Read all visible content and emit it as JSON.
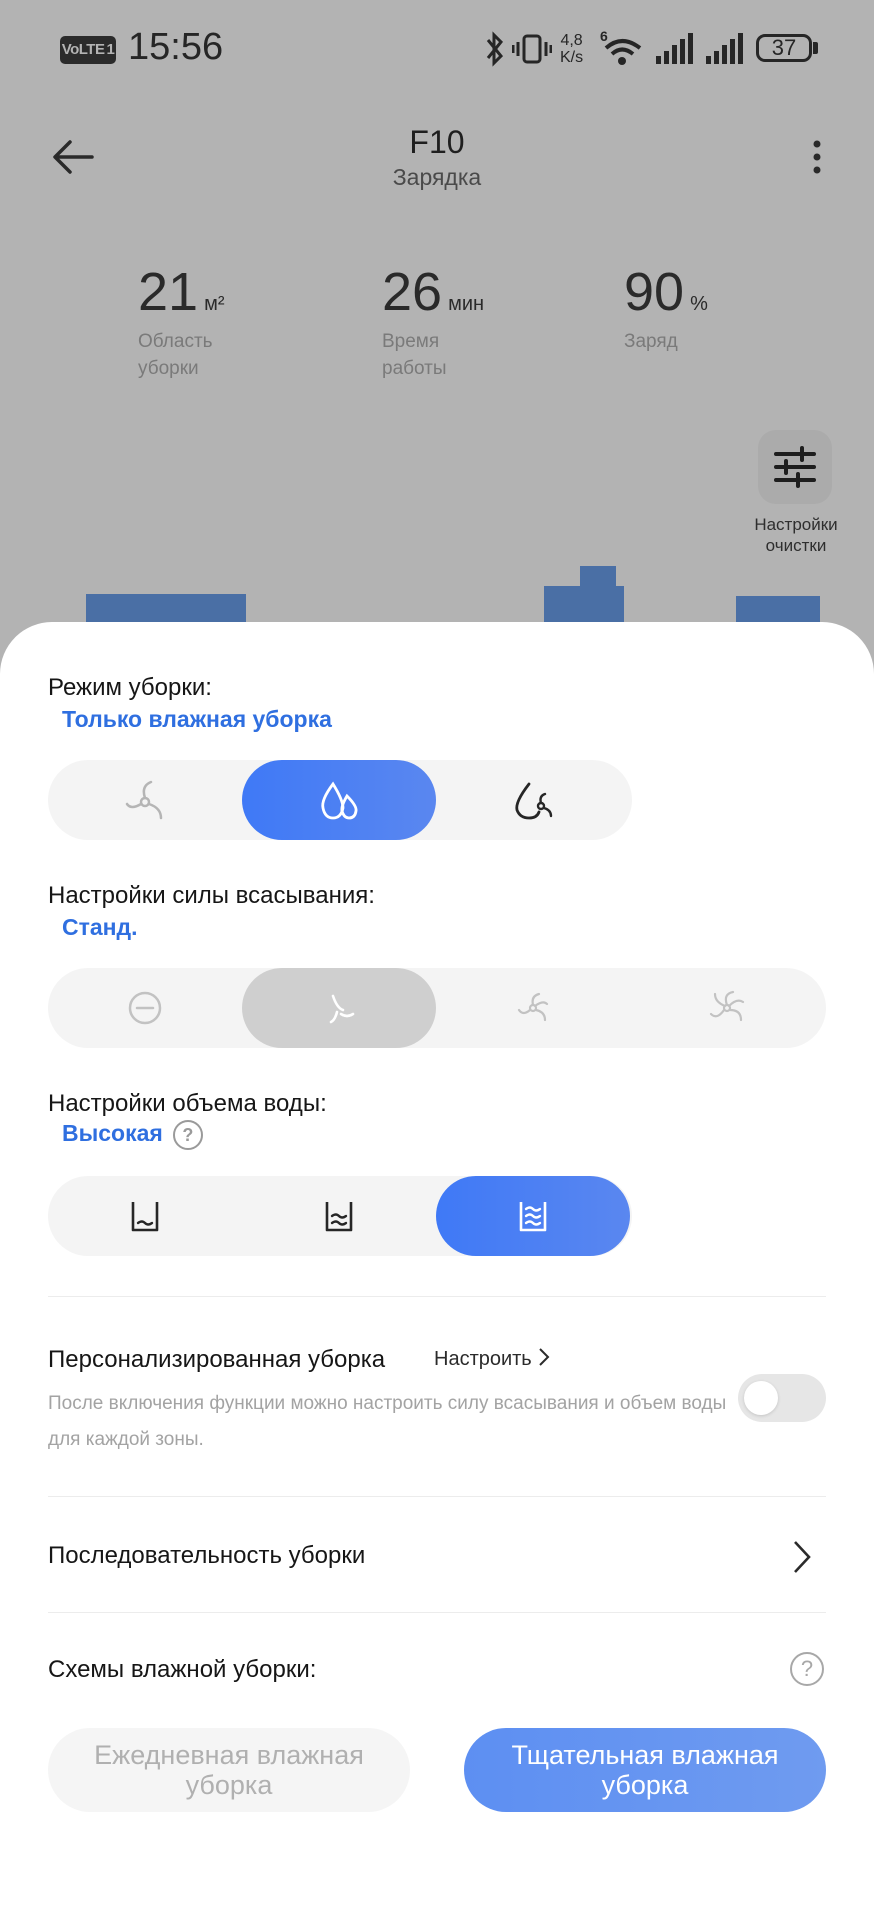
{
  "status_bar": {
    "volte": "VoLTE",
    "sim": "1",
    "time": "15:56",
    "net_speed_top": "4,8",
    "net_speed_bottom": "K/s",
    "wifi_badge": "6",
    "battery": "37"
  },
  "header": {
    "title": "F10",
    "subtitle": "Зарядка"
  },
  "stats": [
    {
      "value": "21",
      "unit": "м²",
      "label": "Область уборки"
    },
    {
      "value": "26",
      "unit": "мин",
      "label": "Время работы"
    },
    {
      "value": "90",
      "unit": "%",
      "label": "Заряд"
    }
  ],
  "clean_settings_label": "Настройки очистки",
  "cleaning_mode": {
    "title": "Режим уборки:",
    "value": "Только влажная уборка",
    "options": [
      "vacuum-icon",
      "mop-drops-icon",
      "vacuum-and-mop-icon"
    ],
    "selected": 1
  },
  "suction": {
    "title": "Настройки силы всасывания:",
    "value": "Станд.",
    "options": [
      "suction-off-icon",
      "suction-standard-icon",
      "suction-strong-icon",
      "suction-max-icon"
    ],
    "selected": 1
  },
  "water": {
    "title": "Настройки объема воды:",
    "value": "Высокая",
    "help": "?",
    "options": [
      "water-low-icon",
      "water-medium-icon",
      "water-high-icon"
    ],
    "selected": 2
  },
  "personalized": {
    "title": "Персонализированная уборка",
    "configure": "Настроить",
    "description": "После включения функции можно настроить силу всасывания и объем воды для каждой зоны.",
    "enabled": false
  },
  "sequence": {
    "title": "Последовательность уборки"
  },
  "wet_schemes": {
    "title": "Схемы влажной уборки:",
    "help": "?",
    "daily": "Ежедневная влажная уборка",
    "deep": "Тщательная влажная уборка",
    "selected": "deep"
  }
}
